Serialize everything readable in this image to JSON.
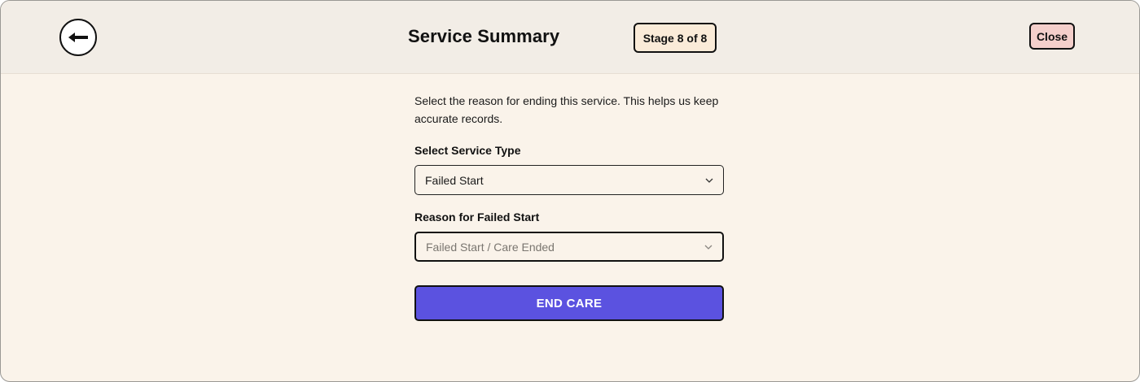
{
  "header": {
    "back_icon": "arrow-left-icon",
    "title": "Service Summary",
    "stage_badge": "Stage 8 of 8",
    "close_label": "Close"
  },
  "form": {
    "instructions": "Select the reason for ending this service. This helps us keep accurate records.",
    "service_type": {
      "label": "Select Service Type",
      "value": "Failed Start"
    },
    "reason": {
      "label": "Reason for Failed Start",
      "value": "Failed Start / Care Ended"
    },
    "submit_label": "END CARE"
  },
  "colors": {
    "page_background": "#faf3ea",
    "header_background": "#f2ede6",
    "stage_badge_background": "#faebd8",
    "close_background": "#f4cfcb",
    "primary_button": "#5b52e0"
  }
}
